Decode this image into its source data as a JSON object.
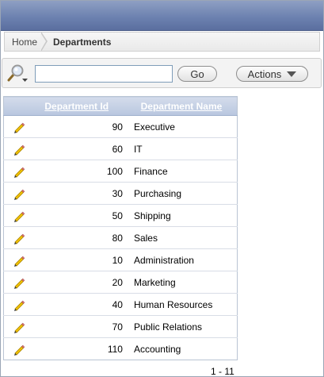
{
  "breadcrumb": {
    "home": "Home",
    "current": "Departments"
  },
  "search": {
    "value": "",
    "placeholder": "",
    "go_label": "Go",
    "actions_label": "Actions"
  },
  "table": {
    "headers": {
      "dept_id": "Department Id",
      "dept_name": "Department Name"
    },
    "rows": [
      {
        "id": "90",
        "name": "Executive"
      },
      {
        "id": "60",
        "name": "IT"
      },
      {
        "id": "100",
        "name": "Finance"
      },
      {
        "id": "30",
        "name": "Purchasing"
      },
      {
        "id": "50",
        "name": "Shipping"
      },
      {
        "id": "80",
        "name": "Sales"
      },
      {
        "id": "10",
        "name": "Administration"
      },
      {
        "id": "20",
        "name": "Marketing"
      },
      {
        "id": "40",
        "name": "Human Resources"
      },
      {
        "id": "70",
        "name": "Public Relations"
      },
      {
        "id": "110",
        "name": "Accounting"
      }
    ]
  },
  "pagination": {
    "range": "1 - 11"
  },
  "colors": {
    "header_bar": "#6d82b0",
    "table_header": "#b8c6df"
  },
  "icons": {
    "search": "search-options-icon",
    "edit": "pencil-edit-icon",
    "dropdown": "caret-down-icon"
  }
}
